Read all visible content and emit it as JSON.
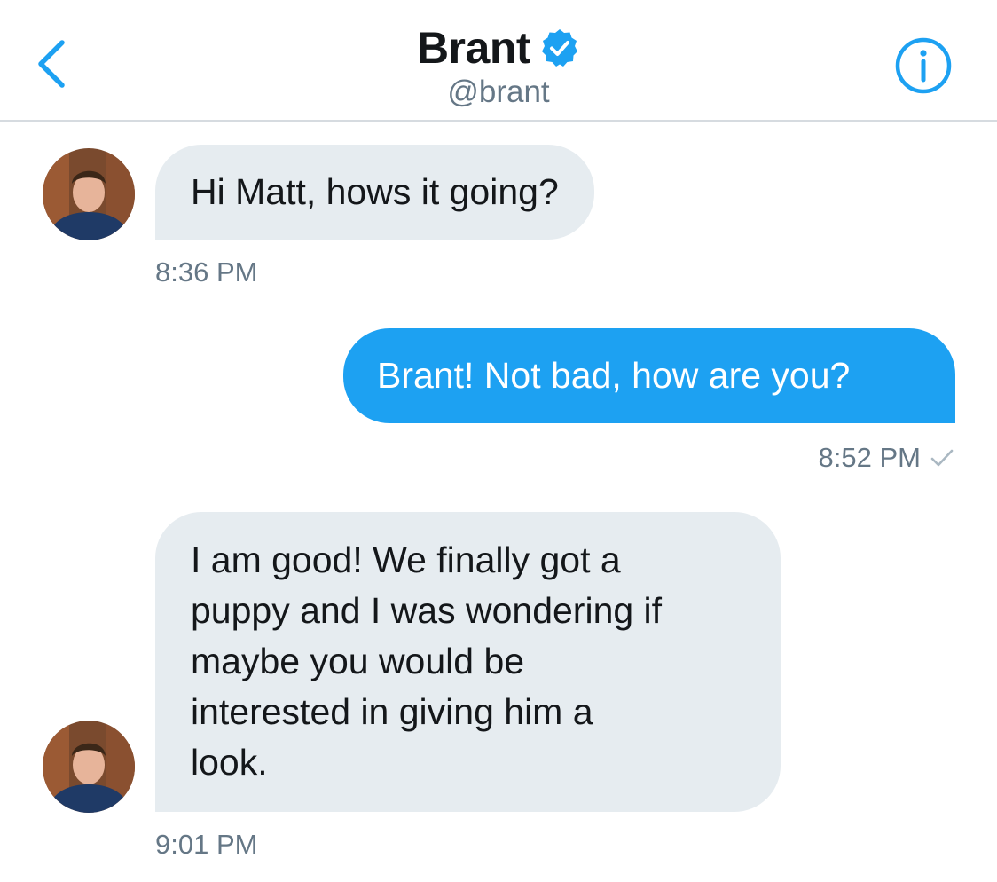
{
  "header": {
    "title": "Brant",
    "handle": "@brant",
    "back_icon": "chevron-left-icon",
    "verified_icon": "verified-badge-icon",
    "info_icon": "info-icon",
    "accent_color": "#1da1f2"
  },
  "messages": [
    {
      "direction": "incoming",
      "text": "Hi Matt, hows it going?",
      "time": "8:36 PM"
    },
    {
      "direction": "outgoing",
      "text": "Brant! Not bad, how are you?",
      "time": "8:52 PM",
      "status_icon": "read-check-icon"
    },
    {
      "direction": "incoming",
      "lines": [
        "I am good! We finally got a",
        "puppy and I was wondering if",
        "maybe you would be",
        "interested in giving him a",
        "look."
      ],
      "time": "9:01 PM"
    }
  ],
  "colors": {
    "incoming_bubble": "#e6ecf0",
    "outgoing_bubble": "#1da1f2",
    "timestamp": "#657786",
    "divider": "#d6dbe0"
  }
}
